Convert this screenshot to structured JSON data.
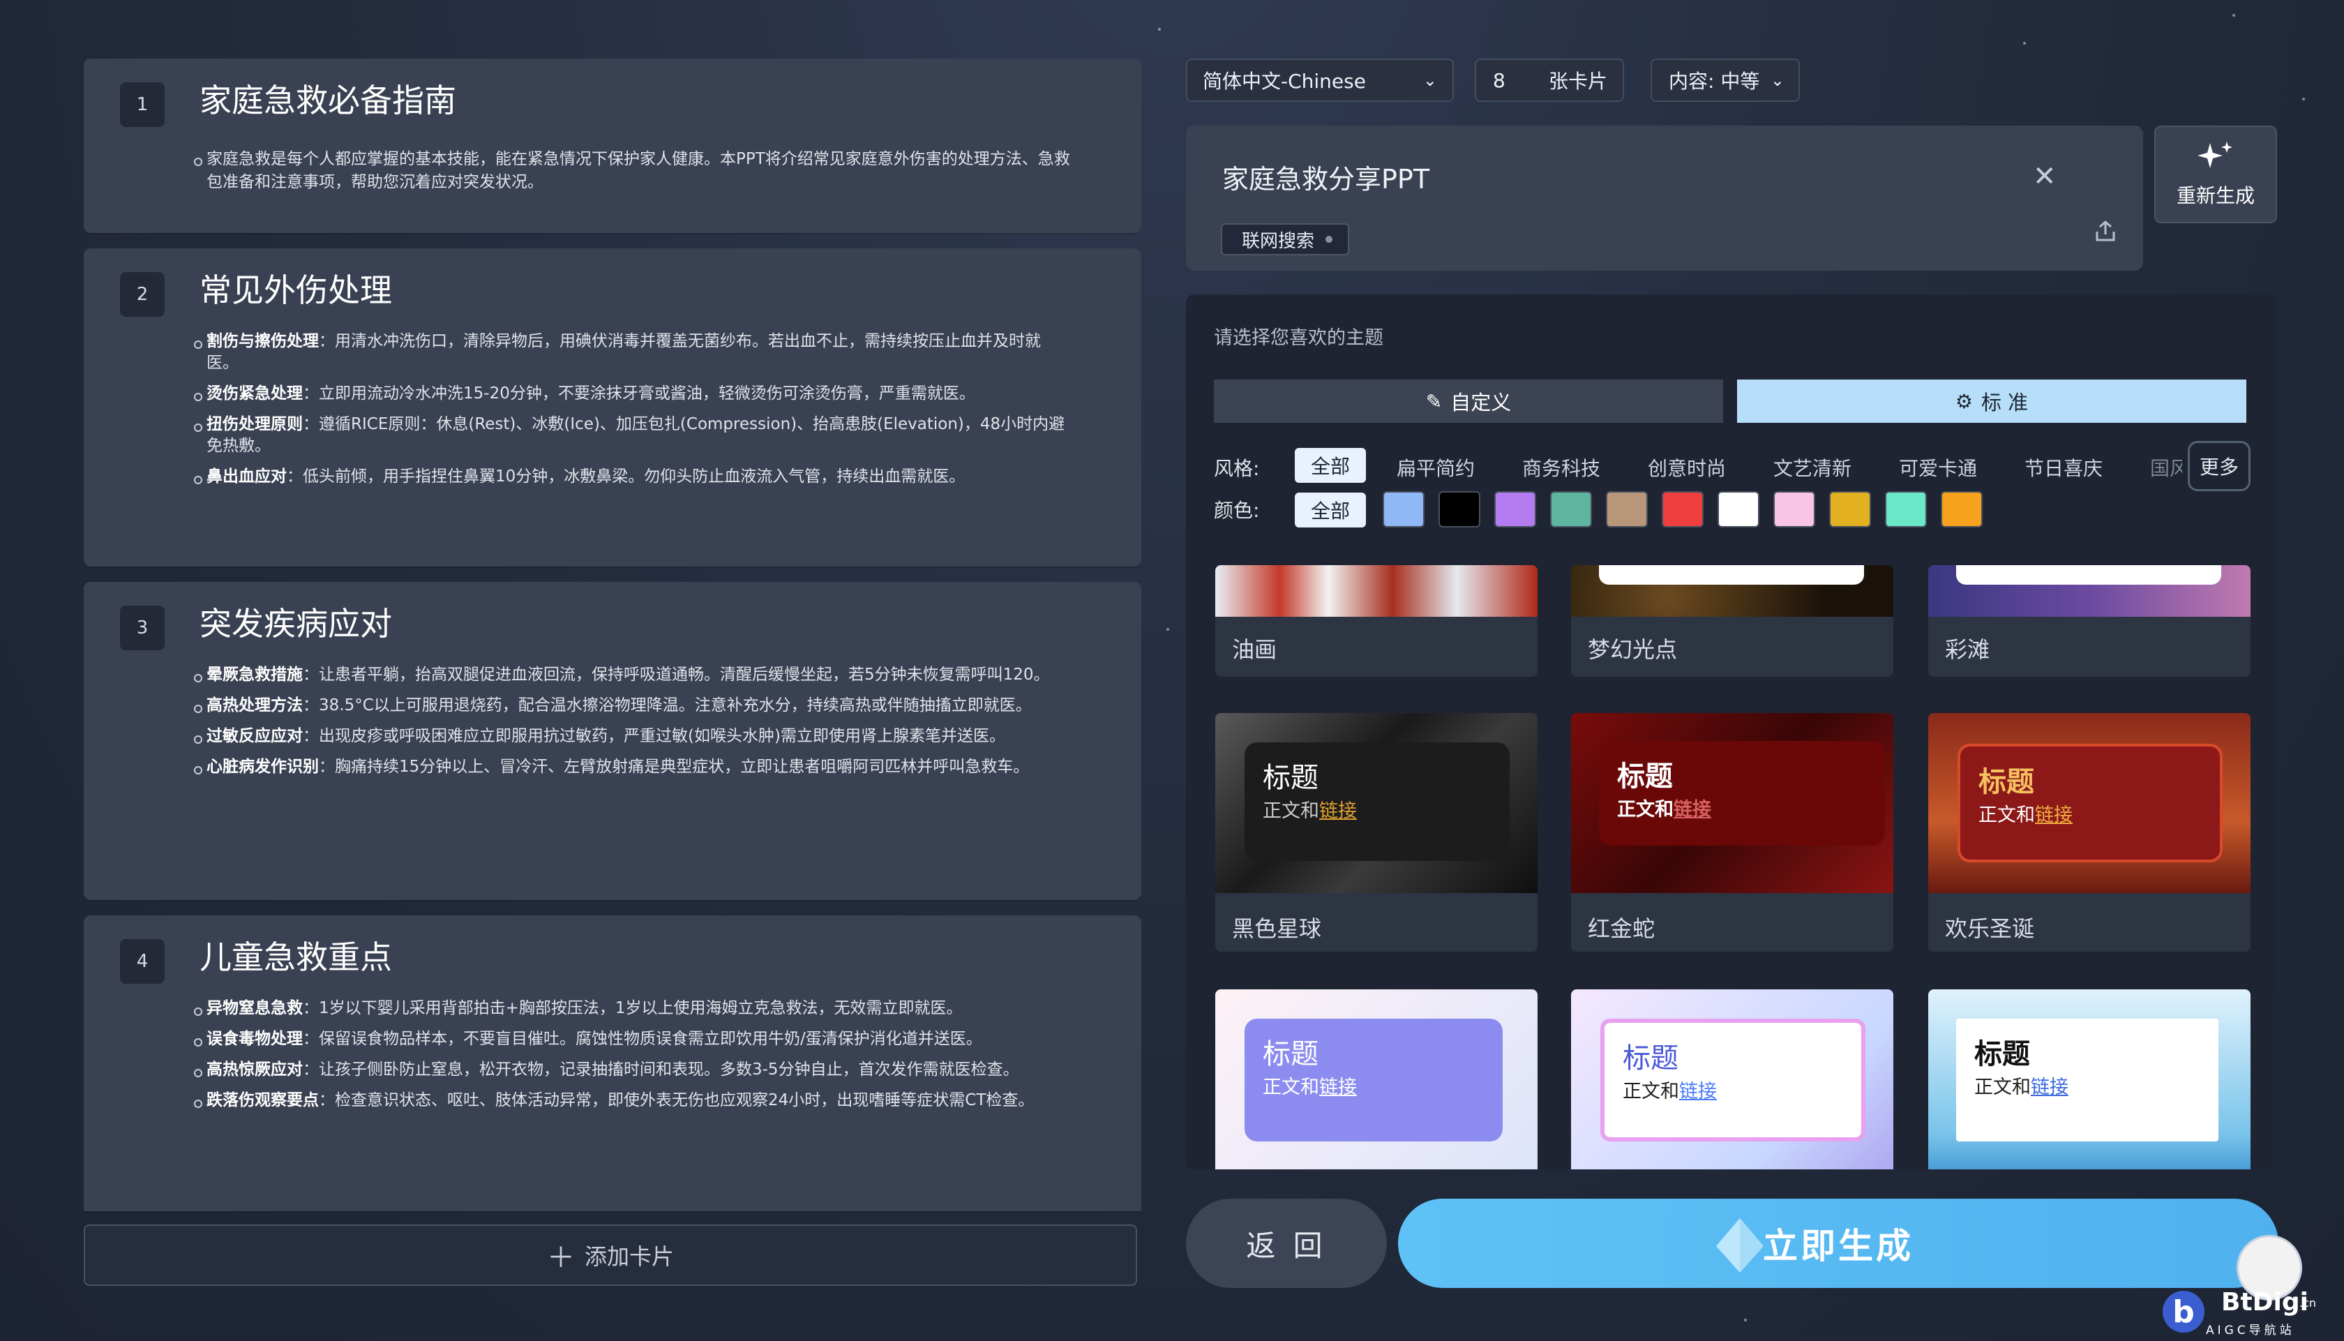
{
  "outline": {
    "cards": [
      {
        "num": "1",
        "title": "家庭急救必备指南",
        "intro": "家庭急救是每个人都应掌握的基本技能，能在紧急情况下保护家人健康。本PPT将介绍常见家庭意外伤害的处理方法、急救包准备和注意事项，帮助您沉着应对突发状况。"
      },
      {
        "num": "2",
        "title": "常见外伤处理",
        "bullets": [
          {
            "h": "割伤与擦伤处理",
            "t": "：用清水冲洗伤口，清除异物后，用碘伏消毒并覆盖无菌纱布。若出血不止，需持续按压止血并及时就医。"
          },
          {
            "h": "烫伤紧急处理",
            "t": "：立即用流动冷水冲洗15-20分钟，不要涂抹牙膏或酱油，轻微烫伤可涂烫伤膏，严重需就医。"
          },
          {
            "h": "扭伤处理原则",
            "t": "：遵循RICE原则：休息(Rest)、冰敷(Ice)、加压包扎(Compression)、抬高患肢(Elevation)，48小时内避免热敷。"
          },
          {
            "h": "鼻出血应对",
            "t": "：低头前倾，用手指捏住鼻翼10分钟，冰敷鼻梁。勿仰头防止血液流入气管，持续出血需就医。"
          }
        ]
      },
      {
        "num": "3",
        "title": "突发疾病应对",
        "bullets": [
          {
            "h": "晕厥急救措施",
            "t": "：让患者平躺，抬高双腿促进血液回流，保持呼吸道通畅。清醒后缓慢坐起，若5分钟未恢复需呼叫120。"
          },
          {
            "h": "高热处理方法",
            "t": "：38.5°C以上可服用退烧药，配合温水擦浴物理降温。注意补充水分，持续高热或伴随抽搐立即就医。"
          },
          {
            "h": "过敏反应应对",
            "t": "：出现皮疹或呼吸困难应立即服用抗过敏药，严重过敏(如喉头水肿)需立即使用肾上腺素笔并送医。"
          },
          {
            "h": "心脏病发作识别",
            "t": "：胸痛持续15分钟以上、冒冷汗、左臂放射痛是典型症状，立即让患者咀嚼阿司匹林并呼叫急救车。"
          }
        ]
      },
      {
        "num": "4",
        "title": "儿童急救重点",
        "bullets": [
          {
            "h": "异物窒息急救",
            "t": "：1岁以下婴儿采用背部拍击+胸部按压法，1岁以上使用海姆立克急救法，无效需立即就医。"
          },
          {
            "h": "误食毒物处理",
            "t": "：保留误食物品样本，不要盲目催吐。腐蚀性物质误食需立即饮用牛奶/蛋清保护消化道并送医。"
          },
          {
            "h": "高热惊厥应对",
            "t": "：让孩子侧卧防止窒息，松开衣物，记录抽搐时间和表现。多数3-5分钟自止，首次发作需就医检查。"
          },
          {
            "h": "跌落伤观察要点",
            "t": "：检查意识状态、呕吐、肢体活动异常，即使外表无伤也应观察24小时，出现嗜睡等症状需CT检查。"
          }
        ]
      }
    ],
    "add_card": "添加卡片"
  },
  "settings": {
    "language": "简体中文-Chinese",
    "card_count": "8",
    "card_unit": "张卡片",
    "content": "内容: 中等"
  },
  "prompt": {
    "text": "家庭急救分享PPT",
    "web_search": "联网搜索",
    "regen": "重新生成"
  },
  "theme": {
    "prompt": "请选择您喜欢的主题",
    "tab_custom": "自定义",
    "tab_standard": "标 准",
    "style_label": "风格:",
    "color_label": "颜色:",
    "styles": [
      "全部",
      "扁平简约",
      "商务科技",
      "创意时尚",
      "文艺清新",
      "可爱卡通",
      "节日喜庆",
      "国风"
    ],
    "more": "更多",
    "colors_all": "全部",
    "swatches": [
      "#8fb8f6",
      "#000000",
      "#b37cf0",
      "#5eb6a0",
      "#b8967a",
      "#ee3e3e",
      "#ffffff",
      "#f8c6e4",
      "#e2b020",
      "#6be8c8",
      "#f6a21c"
    ],
    "sample_title": "标题",
    "sample_body": "正文和",
    "sample_link": "链接",
    "cards": [
      "油画",
      "梦幻光点",
      "彩滩",
      "黑色星球",
      "红金蛇",
      "欢乐圣诞",
      "",
      "",
      ""
    ]
  },
  "actions": {
    "back": "返 回",
    "generate": "立即生成"
  },
  "watermark": {
    "brand": "BtDigi",
    "sub": "AIGC导航站",
    "domain": ".cn"
  }
}
